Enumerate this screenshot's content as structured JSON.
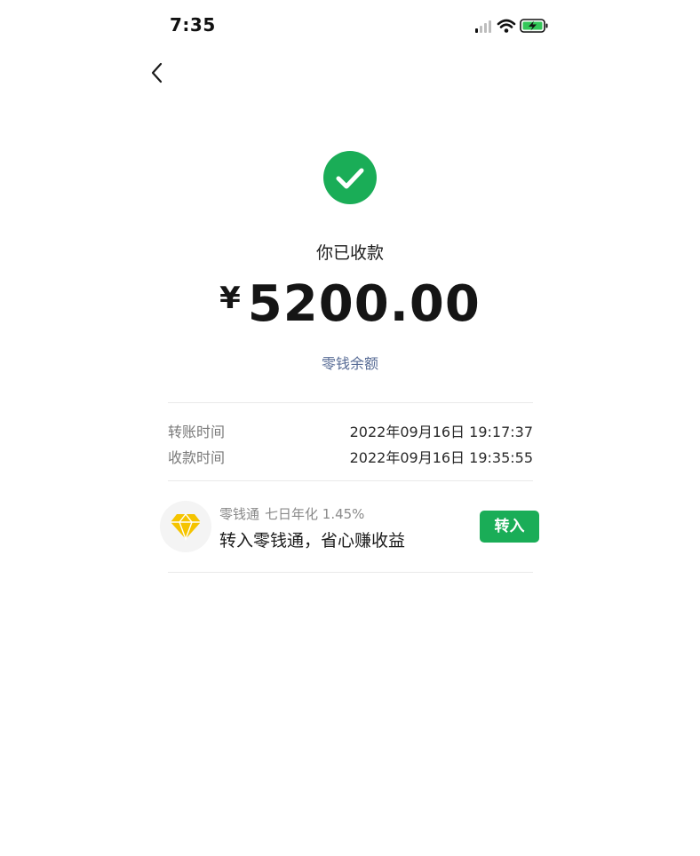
{
  "status_bar": {
    "time": "7:35"
  },
  "colors": {
    "accent_green": "#1aad57",
    "link_blue": "#576b95",
    "label_gray": "#7a7a7a",
    "diamond_yellow": "#f5c400"
  },
  "icons": {
    "back": "chevron-left-icon",
    "success": "check-circle-icon",
    "signal": "cellular-signal-icon",
    "wifi": "wifi-icon",
    "battery": "battery-charging-icon",
    "promo": "diamond-icon"
  },
  "receipt": {
    "title": "你已收款",
    "currency": "¥",
    "amount": "5200.00",
    "balance_link": "零钱余额"
  },
  "details": [
    {
      "label": "转账时间",
      "value": "2022年09月16日 19:17:37"
    },
    {
      "label": "收款时间",
      "value": "2022年09月16日 19:35:55"
    }
  ],
  "promo": {
    "product": "零钱通",
    "rate": "七日年化 1.45%",
    "headline": "转入零钱通，省心赚收益",
    "button_label": "转入"
  }
}
